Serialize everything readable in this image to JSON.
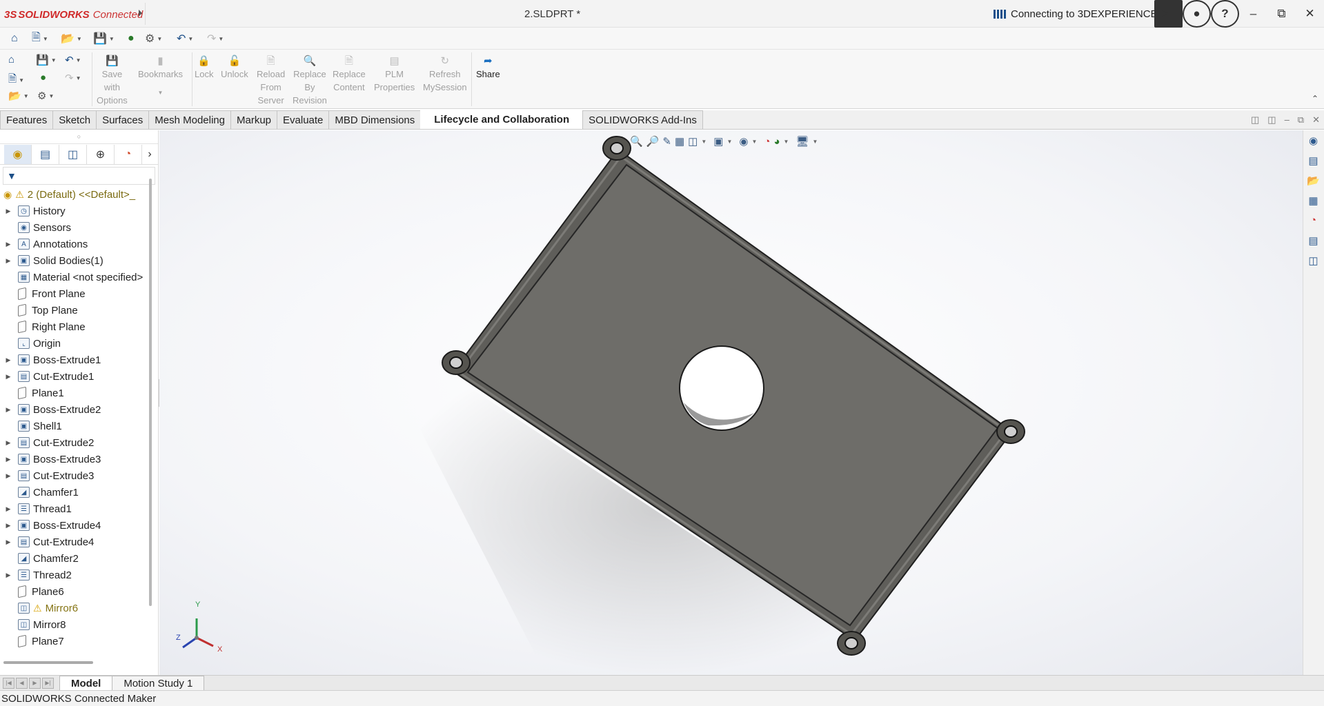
{
  "titlebar": {
    "brand_ds": "3S",
    "brand": "SOLIDWORKS",
    "brand_suffix": "Connected",
    "document": "2.SLDPRT *",
    "connection_status": "Connecting to 3DEXPERIENCE...",
    "icons": [
      "terminal-icon",
      "account-icon",
      "help-icon",
      "minimize-icon",
      "restore-icon",
      "close-icon"
    ],
    "brand_color": "#d02a2a"
  },
  "quick_access": {
    "icons": [
      "home-icon",
      "new-icon",
      "open-icon",
      "save-icon",
      "rebuild-icon",
      "options-icon",
      "undo-icon",
      "redo-icon"
    ]
  },
  "ribbon": {
    "groups": [
      {
        "id": "save-with-options",
        "lines": [
          "Save",
          "with",
          "Options"
        ],
        "enabled": false
      },
      {
        "id": "bookmarks",
        "lines": [
          "Bookmarks"
        ],
        "enabled": false
      },
      {
        "id": "lock",
        "lines": [
          "Lock"
        ],
        "enabled": false
      },
      {
        "id": "unlock",
        "lines": [
          "Unlock"
        ],
        "enabled": false
      },
      {
        "id": "reload",
        "lines": [
          "Reload",
          "From",
          "Server"
        ],
        "enabled": false
      },
      {
        "id": "replace-revision",
        "lines": [
          "Replace",
          "By",
          "Revision"
        ],
        "enabled": false
      },
      {
        "id": "replace-content",
        "lines": [
          "Replace",
          "Content"
        ],
        "enabled": false
      },
      {
        "id": "plm",
        "lines": [
          "PLM",
          "Properties"
        ],
        "enabled": false
      },
      {
        "id": "refresh",
        "lines": [
          "Refresh",
          "MySession"
        ],
        "enabled": false
      },
      {
        "id": "share",
        "lines": [
          "Share"
        ],
        "enabled": true
      }
    ]
  },
  "command_tabs": [
    {
      "label": "Features",
      "active": false
    },
    {
      "label": "Sketch",
      "active": false
    },
    {
      "label": "Surfaces",
      "active": false
    },
    {
      "label": "Mesh Modeling",
      "active": false
    },
    {
      "label": "Markup",
      "active": false
    },
    {
      "label": "Evaluate",
      "active": false
    },
    {
      "label": "MBD Dimensions",
      "active": false
    },
    {
      "label": "Lifecycle and Collaboration",
      "active": true
    },
    {
      "label": "SOLIDWORKS Add-Ins",
      "active": false
    }
  ],
  "feature_manager": {
    "root": "2 (Default) <<Default>_",
    "items": [
      {
        "label": "History",
        "expandable": true,
        "icon": "history-icon"
      },
      {
        "label": "Sensors",
        "expandable": false,
        "icon": "sensors-icon"
      },
      {
        "label": "Annotations",
        "expandable": true,
        "icon": "annotations-icon"
      },
      {
        "label": "Solid Bodies(1)",
        "expandable": true,
        "icon": "solid-bodies-icon"
      },
      {
        "label": "Material <not specified>",
        "expandable": false,
        "icon": "material-icon"
      },
      {
        "label": "Front Plane",
        "expandable": false,
        "icon": "plane-icon"
      },
      {
        "label": "Top Plane",
        "expandable": false,
        "icon": "plane-icon"
      },
      {
        "label": "Right Plane",
        "expandable": false,
        "icon": "plane-icon"
      },
      {
        "label": "Origin",
        "expandable": false,
        "icon": "origin-icon"
      },
      {
        "label": "Boss-Extrude1",
        "expandable": true,
        "icon": "boss-extrude-icon"
      },
      {
        "label": "Cut-Extrude1",
        "expandable": true,
        "icon": "cut-extrude-icon"
      },
      {
        "label": "Plane1",
        "expandable": false,
        "icon": "plane-icon"
      },
      {
        "label": "Boss-Extrude2",
        "expandable": true,
        "icon": "boss-extrude-icon"
      },
      {
        "label": "Shell1",
        "expandable": false,
        "icon": "shell-icon"
      },
      {
        "label": "Cut-Extrude2",
        "expandable": true,
        "icon": "cut-extrude-icon"
      },
      {
        "label": "Boss-Extrude3",
        "expandable": true,
        "icon": "boss-extrude-icon"
      },
      {
        "label": "Cut-Extrude3",
        "expandable": true,
        "icon": "cut-extrude-icon"
      },
      {
        "label": "Chamfer1",
        "expandable": false,
        "icon": "chamfer-icon"
      },
      {
        "label": "Thread1",
        "expandable": true,
        "icon": "thread-icon"
      },
      {
        "label": "Boss-Extrude4",
        "expandable": true,
        "icon": "boss-extrude-icon"
      },
      {
        "label": "Cut-Extrude4",
        "expandable": true,
        "icon": "cut-extrude-icon"
      },
      {
        "label": "Chamfer2",
        "expandable": false,
        "icon": "chamfer-icon"
      },
      {
        "label": "Thread2",
        "expandable": true,
        "icon": "thread-icon"
      },
      {
        "label": "Plane6",
        "expandable": false,
        "icon": "plane-icon"
      },
      {
        "label": "Mirror6",
        "expandable": false,
        "icon": "mirror-icon",
        "warning": true
      },
      {
        "label": "Mirror8",
        "expandable": false,
        "icon": "mirror-icon"
      },
      {
        "label": "Plane7",
        "expandable": false,
        "icon": "plane-icon"
      }
    ]
  },
  "viewport": {
    "triad": {
      "x": "X",
      "y": "Y",
      "z": "Z"
    },
    "part_color": "#6b6a66",
    "background": "#f4f5f8"
  },
  "bottom_tabs": [
    {
      "label": "Model",
      "active": true
    },
    {
      "label": "Motion Study 1",
      "active": false
    }
  ],
  "status_bar": "SOLIDWORKS Connected Maker"
}
